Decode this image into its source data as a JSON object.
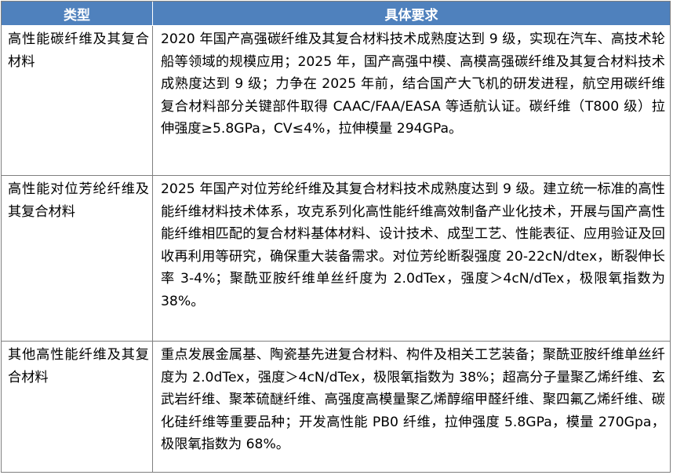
{
  "table": {
    "headers": [
      "类型",
      "具体要求"
    ],
    "rows": [
      {
        "type": "高性能碳纤维及其复合材料",
        "requirement": "2020 年国产高强碳纤维及其复合材料技术成熟度达到 9 级，实现在汽车、高技术轮船等领域的规模应用；2025 年，国产高强中模、高模高强碳纤维及其复合材料技术成熟度达到 9 级；力争在 2025 年前，结合国产大飞机的研发进程，航空用碳纤维复合材料部分关键部件取得 CAAC/FAA/EASA 等适航认证。碳纤维（T800 级）拉伸强度≥5.8GPa，CV≤4%，拉伸模量 294GPa。"
      },
      {
        "type": "高性能对位芳纶纤维及其复合材料",
        "requirement": "2025 年国产对位芳纶纤维及其复合材料技术成熟度达到 9 级。建立统一标准的高性能纤维材料技术体系，攻克系列化高性能纤维高效制备产业化技术，开展与国产高性能纤维相匹配的复合材料基体材料、设计技术、成型工艺、性能表征、应用验证及回收再利用等研究，确保重大装备需求。对位芳纶断裂强度 20-22cN/dtex，断裂伸长率 3-4%；聚酰亚胺纤维单丝纤度为 2.0dTex，强度＞4cN/dTex，极限氧指数为 38%。"
      },
      {
        "type": "其他高性能纤维及其复合材料",
        "requirement": "重点发展金属基、陶瓷基先进复合材料、构件及相关工艺装备；聚酰亚胺纤维单丝纤度为 2.0dTex，强度＞4cN/dTex，极限氧指数为 38%；超高分子量聚乙烯纤维、玄武岩纤维、聚苯硫醚纤维、高强度高模量聚乙烯醇缩甲醛纤维、聚四氟乙烯纤维、碳化硅纤维等重要品种；开发高性能 PB0 纤维，拉伸强度 5.8GPa，模量 270Gpa，极限氧指数为 68%。"
      }
    ]
  }
}
